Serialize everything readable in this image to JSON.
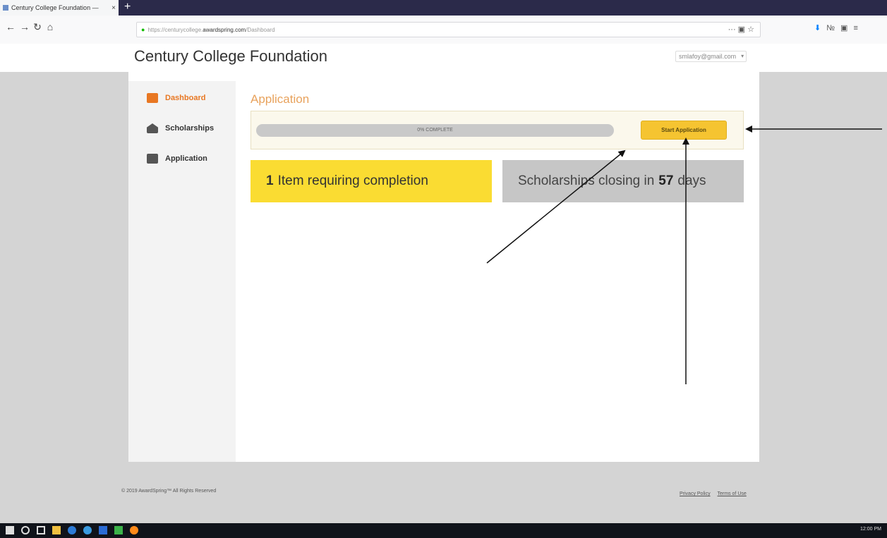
{
  "browser": {
    "tab_title": "Century College Foundation —",
    "tab_close": "×",
    "new_tab": "+",
    "url_prefix": "https://centurycollege.",
    "url_host": "awardspring.com",
    "url_path": "/Dashboard",
    "url_actions": "··· ▣ ☆",
    "nav": {
      "back": "←",
      "forward": "→",
      "reload": "↻",
      "home": "⌂"
    }
  },
  "header": {
    "site_title": "Century College Foundation",
    "account_email": "smlafoy@gmail.com",
    "account_caret": "▾"
  },
  "sidebar": {
    "items": [
      {
        "label": "Dashboard",
        "icon": "dashboard-icon",
        "color": "#e87722"
      },
      {
        "label": "Scholarships",
        "icon": "scholarships-icon",
        "color": "#555555"
      },
      {
        "label": "Application",
        "icon": "application-icon",
        "color": "#555555"
      }
    ]
  },
  "main": {
    "title": "Application",
    "progress": {
      "percent": 0,
      "label": "0% COMPLETE"
    },
    "start_button": "Start Application",
    "cards": {
      "items_count": "1",
      "items_text": "Item requiring completion",
      "closing_prefix": "Scholarships closing in",
      "closing_days": "57",
      "closing_suffix": "days"
    }
  },
  "footer": {
    "copyright": "© 2019 AwardSpring™ All Rights Reserved",
    "privacy": "Privacy Policy",
    "terms": "Terms of Use"
  },
  "taskbar": {
    "clock": "12:00 PM"
  },
  "colors": {
    "accent": "#e87722",
    "button": "#f5c431",
    "yellow_card": "#fadc32",
    "grey_card": "#c6c6c6"
  }
}
